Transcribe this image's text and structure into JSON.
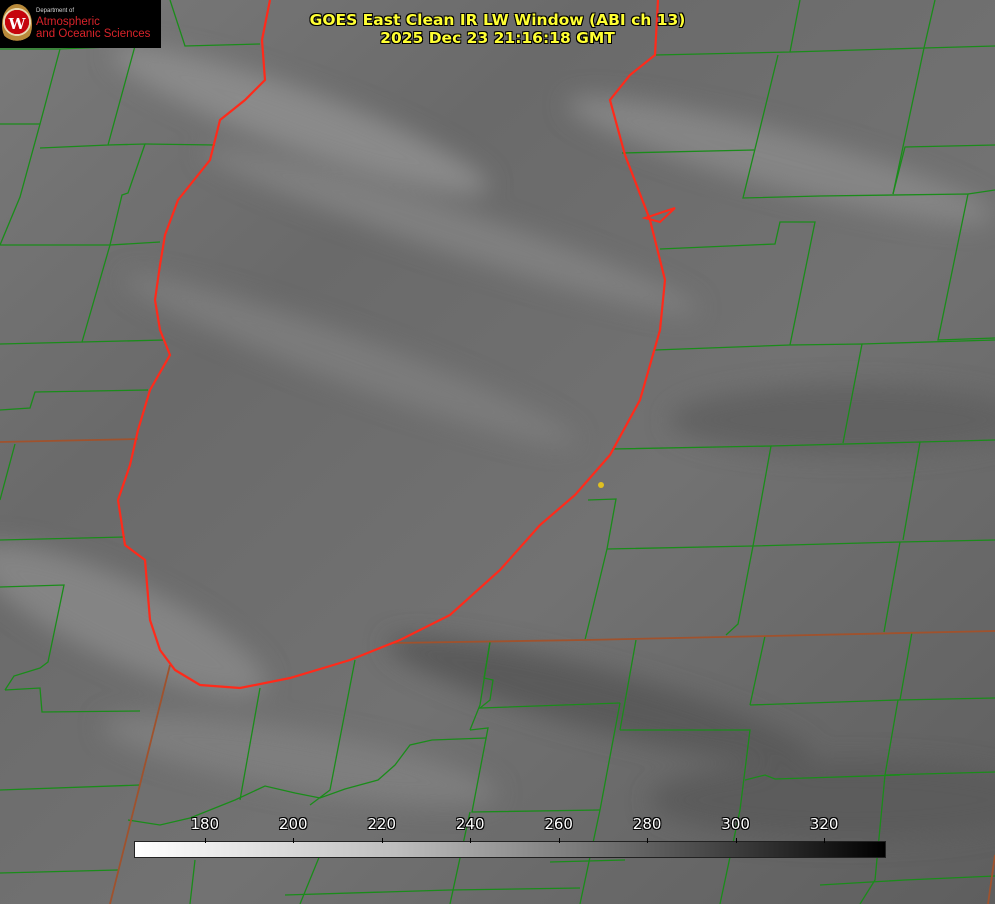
{
  "header": {
    "title_line1": "GOES East Clean IR LW Window (ABI ch 13)",
    "title_line2": "2025 Dec 23 21:16:18 GMT"
  },
  "logo": {
    "seal_letter": "W",
    "dept": "Department of",
    "line1": "Atmospheric",
    "line2": "and Oceanic Sciences"
  },
  "colorbar": {
    "min": 164,
    "max": 334,
    "ticks": [
      "180",
      "200",
      "220",
      "240",
      "260",
      "280",
      "300",
      "320"
    ],
    "tick_values": [
      180,
      200,
      220,
      240,
      260,
      280,
      300,
      320
    ]
  },
  "colors": {
    "county_lines": "#1a8c1a",
    "state_lines": "#8b4513",
    "lake_outline": "#ff2020",
    "marker": "#e0c020",
    "title": "#ffff33"
  }
}
